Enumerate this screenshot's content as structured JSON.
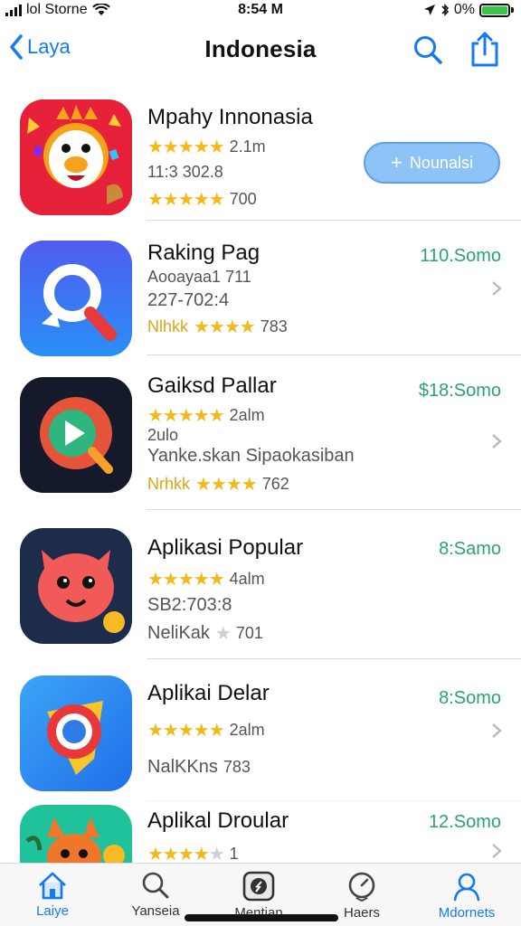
{
  "status_bar": {
    "carrier": "lol Storne",
    "time": "8:54 M",
    "battery": "0%"
  },
  "nav": {
    "back_label": "Laya",
    "title": "Indonesia"
  },
  "apps": [
    {
      "name": "Mpahy Innonasia",
      "meta1": "2.1m",
      "meta2": "11:3 302.8",
      "meta3": "700",
      "action_label": "Nounalsi",
      "rating": 4.5
    },
    {
      "name": "Raking Pag",
      "meta1": "Aooayaa1 711",
      "meta2": "227-702:4",
      "meta3_label": "Nlhkk",
      "meta3": "783",
      "price": "110.Somo",
      "rating": 4.5
    },
    {
      "name": "Gaiksd Pallar",
      "meta1": "2alm",
      "meta1b": "2ulo",
      "meta2": "Yanke.skan Sipaokasiban",
      "meta3_label": "Nrhkk",
      "meta3": "762",
      "price": "$18:Somo",
      "rating": 5
    },
    {
      "name": "Aplikasi Popular",
      "meta1": "4alm",
      "meta2": "SB2:703:8",
      "meta3_label": "NeliKak",
      "meta3": "701",
      "price": "8:Samo",
      "rating": 5
    },
    {
      "name": "Aplikai Delar",
      "meta1": "2alm",
      "meta3_label": "NalKKns",
      "meta3": "783",
      "price": "8:Somo",
      "rating": 4.5
    },
    {
      "name": "Aplikal Droular",
      "meta1": "1",
      "price": "12.Somo",
      "rating": 3.5
    }
  ],
  "tabs": [
    {
      "label": "Laiye",
      "icon": "home-icon",
      "active": true
    },
    {
      "label": "Yanseia",
      "icon": "search-icon",
      "active": false
    },
    {
      "label": "Mentian",
      "icon": "compass-icon",
      "active": false
    },
    {
      "label": "Haers",
      "icon": "gauge-icon",
      "active": false
    },
    {
      "label": "Mdornets",
      "icon": "person-icon",
      "active": true
    }
  ],
  "colors": {
    "accent": "#1479f5",
    "price": "#2aa46d",
    "star": "#f5b81a",
    "install_bg": "#8ec3f7"
  }
}
